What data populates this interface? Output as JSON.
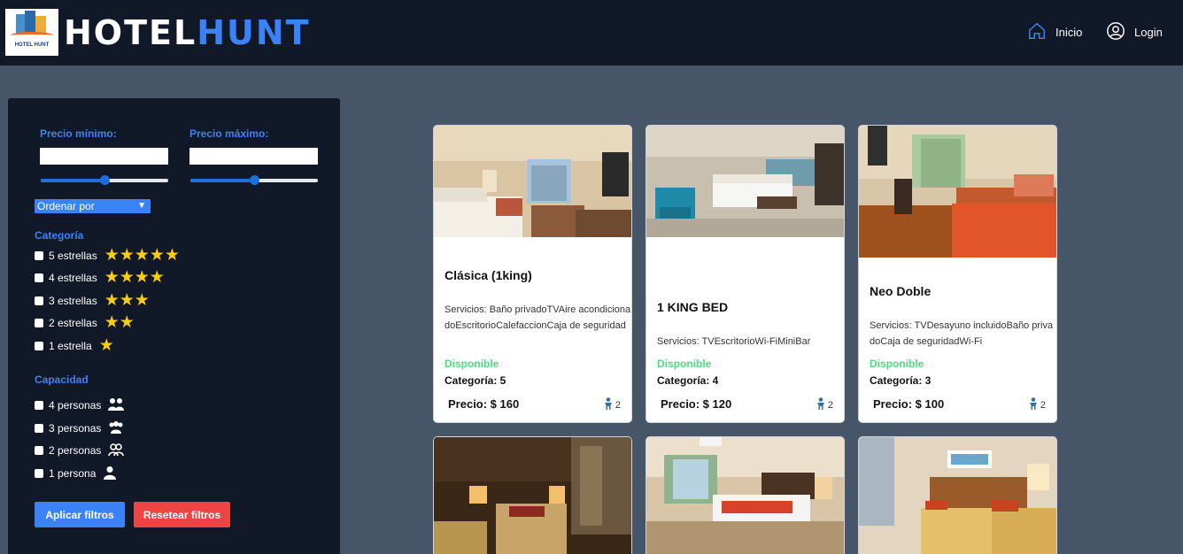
{
  "header": {
    "logo_text": "HOTEL HUNT",
    "brand_part1": "HOTEL",
    "brand_part2": "HUNT",
    "nav": {
      "inicio": "Inicio",
      "login": "Login"
    }
  },
  "filters": {
    "min_label": "Precio mínimo:",
    "max_label": "Precio máximo:",
    "min_value": "",
    "max_value": "",
    "order_label": "Ordenar por",
    "category_title": "Categoría",
    "categories": [
      {
        "label": "5 estrellas",
        "stars": "★★★★★"
      },
      {
        "label": "4 estrellas",
        "stars": "★★★★"
      },
      {
        "label": "3 estrellas",
        "stars": "★★★"
      },
      {
        "label": "2 estrellas",
        "stars": "★★"
      },
      {
        "label": "1 estrella",
        "stars": "★"
      }
    ],
    "capacity_title": "Capacidad",
    "capacities": [
      {
        "label": "4 personas"
      },
      {
        "label": "3 personas"
      },
      {
        "label": "2 personas"
      },
      {
        "label": "1 persona"
      }
    ],
    "apply_label": "Aplicar filtros",
    "reset_label": "Resetear filtros"
  },
  "rooms": [
    {
      "title": "Clásica (1king)",
      "services": "Servicios: Baño privadoTVAire acondicionadoEscritorioCalefaccionCaja de seguridad",
      "status": "Disponible",
      "category": "Categoría: 5",
      "price": "Precio: $ 160",
      "capacity": "2"
    },
    {
      "title": "1 KING BED",
      "services": "Servicios: TVEscritorioWi-FiMiniBar",
      "status": "Disponible",
      "category": "Categoría: 4",
      "price": "Precio: $ 120",
      "capacity": "2"
    },
    {
      "title": "Neo Doble",
      "services": "Servicios: TVDesayuno incluidoBaño privadoCaja de seguridadWi-Fi",
      "status": "Disponible",
      "category": "Categoría: 3",
      "price": "Precio: $ 100",
      "capacity": "2"
    },
    {
      "title": ""
    },
    {
      "title": ""
    },
    {
      "title": ""
    }
  ],
  "colors": {
    "accent": "#3b82f6",
    "danger": "#ef4444",
    "available": "#4ade80",
    "star": "#facc15",
    "nav_bg": "#111827",
    "page_bg": "#475569"
  }
}
